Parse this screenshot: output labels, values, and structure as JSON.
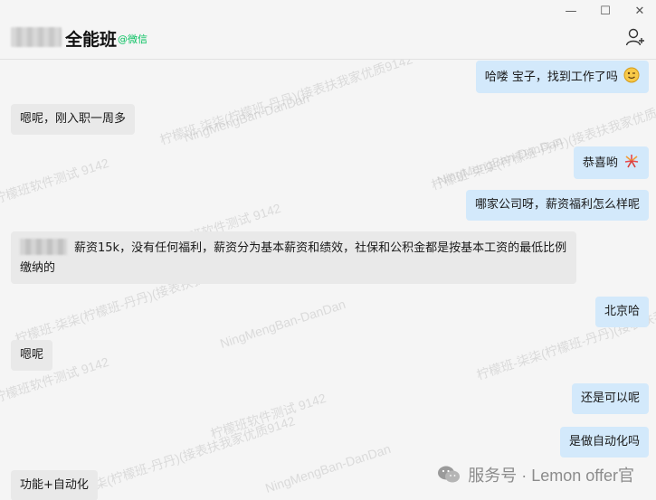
{
  "window": {
    "controls": [
      "—",
      "☐",
      "✕"
    ]
  },
  "header": {
    "title": "全能班",
    "tag": "@微信"
  },
  "messages": [
    {
      "side": "right",
      "text": "哈喽 宝子，找到工作了吗",
      "emoji": "wink-face"
    },
    {
      "side": "left",
      "text": "嗯呢，刚入职一周多"
    },
    {
      "side": "right",
      "text": "恭喜哟",
      "emoji": "fireworks"
    },
    {
      "side": "right",
      "text": "哪家公司呀，薪资福利怎么样呢"
    },
    {
      "side": "left",
      "text": "薪资15k，没有任何福利，薪资分为基本薪资和绩效，社保和公积金都是按基本工资的最低比例缴纳的"
    },
    {
      "side": "right",
      "text": "北京哈"
    },
    {
      "side": "left",
      "text": "嗯呢"
    },
    {
      "side": "right",
      "text": "还是可以呢"
    },
    {
      "side": "right",
      "text": "是做自动化吗"
    },
    {
      "side": "left",
      "text": "功能+自动化"
    }
  ],
  "watermark": {
    "line1": "柠檬班-柒柒(柠檬班-丹丹)(接表扶我家优质9142",
    "line2": "NingMengBan-DanDan",
    "line3": "柠檬班软件测试 9142"
  },
  "footer": {
    "text": "服务号 · Lemon offer官"
  }
}
